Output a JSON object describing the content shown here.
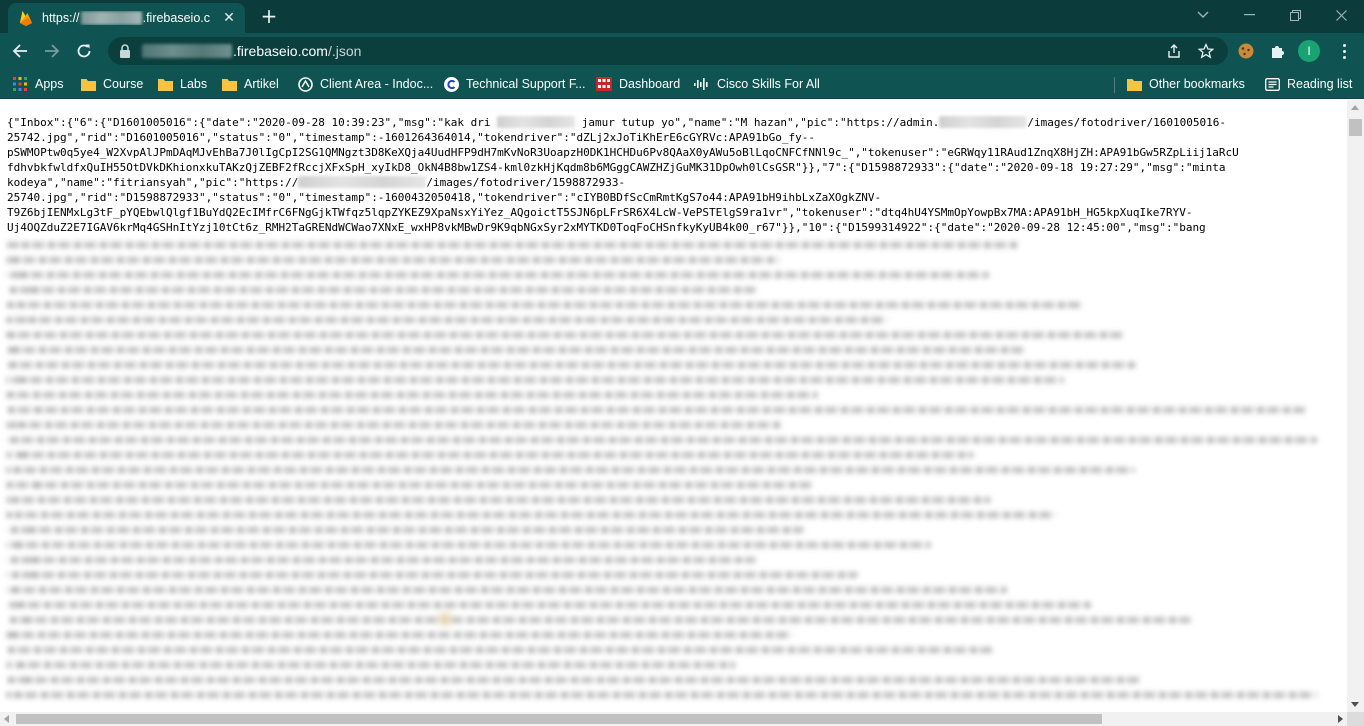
{
  "tab": {
    "title_prefix": "https://",
    "title_suffix": ".firebaseio.c",
    "favicon": "firebase-flame-icon",
    "close_glyph": "✕"
  },
  "new_tab_glyph": "+",
  "address_bar": {
    "url_host": ".firebaseio.com",
    "url_path": "/.json"
  },
  "profile": {
    "initial": "I"
  },
  "bookmarks": {
    "items": [
      {
        "label": "Apps",
        "icon": "apps-grid-icon"
      },
      {
        "label": "Course",
        "icon": "folder-icon"
      },
      {
        "label": "Labs",
        "icon": "folder-icon"
      },
      {
        "label": "Artikel",
        "icon": "folder-icon"
      },
      {
        "label": "Client Area - Indoc...",
        "icon": "site-favicon"
      },
      {
        "label": "Technical Support F...",
        "icon": "site-favicon"
      },
      {
        "label": "Dashboard",
        "icon": "site-favicon"
      },
      {
        "label": "Cisco Skills For All",
        "icon": "site-favicon"
      }
    ],
    "other": "Other bookmarks",
    "reading_list": "Reading list"
  },
  "json_lines": [
    {
      "a": "{\"Inbox\":{\"6\":{\"D1601005016\":{\"date\":\"2020-09-28 10:39:23\",\"msg\":\"kak dri ",
      "b": " jamur tutup yo\",\"name\":\"M hazan\",\"pic\":\"https://admin.",
      "c": "/images/fotodriver/1601005016-"
    },
    {
      "a": "25742.jpg\",\"rid\":\"D1601005016\",\"status\":\"0\",\"timestamp\":-1601264364014,\"tokendriver\":\"dZLj2xJoTiKhErE6cGYRVc:APA91bGo_fy--"
    },
    {
      "a": "pSWMOPtw0q5ye4_W2XvpAlJPmDAqMJvEhBa7J0lIgCpI2SG1QMNgzt3D8KeXQja4UudHFP9dH7mKvNoR3UoapzH0DK1HCHDu6Pv8QAaX0yAWu5oBlLqoCNFCfNNl9c_\",\"tokenuser\":\"eGRWqy11RAud1ZnqX8HjZH:APA91bGw5RZpLiij1aRcU"
    },
    {
      "a": "fdhvbkfwldfxQuIH55OtDVkDKhionxkuTAKzQjZEBF2fRccjXFxSpH_xyIkD8_OkN4B8bw1ZS4-kml0zkHjKqdm8b6MGggCAWZHZjGuMK31DpOwh0lCsGSR\"}},\"7\":{\"D1598872933\":{\"date\":\"2020-09-18 19:27:29\",\"msg\":\"minta"
    },
    {
      "a": "kodeya\",\"name\":\"fitriansyah\",\"pic\":\"https://",
      "b": "/images/fotodriver/1598872933-"
    },
    {
      "a": "25740.jpg\",\"rid\":\"D1598872933\",\"status\":\"0\",\"timestamp\":-1600432050418,\"tokendriver\":\"cIYB0BDfScCmRmtKgS7o44:APA91bH9ihbLxZaXOgkZNV-"
    },
    {
      "a": "T9Z6bjIENMxLg3tF_pYQEbwlQlgf1BuYdQ2EcIMfrC6FNgGjkTWfqz5lqpZYKEZ9XpaNsxYiYez_AQgoictT5SJN6pLFrSR6X4LcW-VePSTElgS9ra1vr\",\"tokenuser\":\"dtq4hU4YSMmOpYowpBx7MA:APA91bH_HG5kpXuqIke7RYV-"
    },
    {
      "a": "Uj4OQZduZ2E7IGAV6krMq4GSHnItYzj10tCt6z_RMH2TaGRENdWCWao7XNxE_wxHP8vkMBwDr9K9qbNGxSyr2xMYTKD0ToqFoCHSnfkyKyUB4k00_r67\"}},\"10\":{\"D1599314922\":{\"date\":\"2020-09-28 12:45:00\",\"msg\":\"bang"
    }
  ],
  "colors": {
    "tabstrip_bg": "#0b3b3a",
    "toolbar_bg": "#0f5453",
    "omnibox_bg": "#0a3f3e",
    "avatar_bg": "#1aa372"
  }
}
